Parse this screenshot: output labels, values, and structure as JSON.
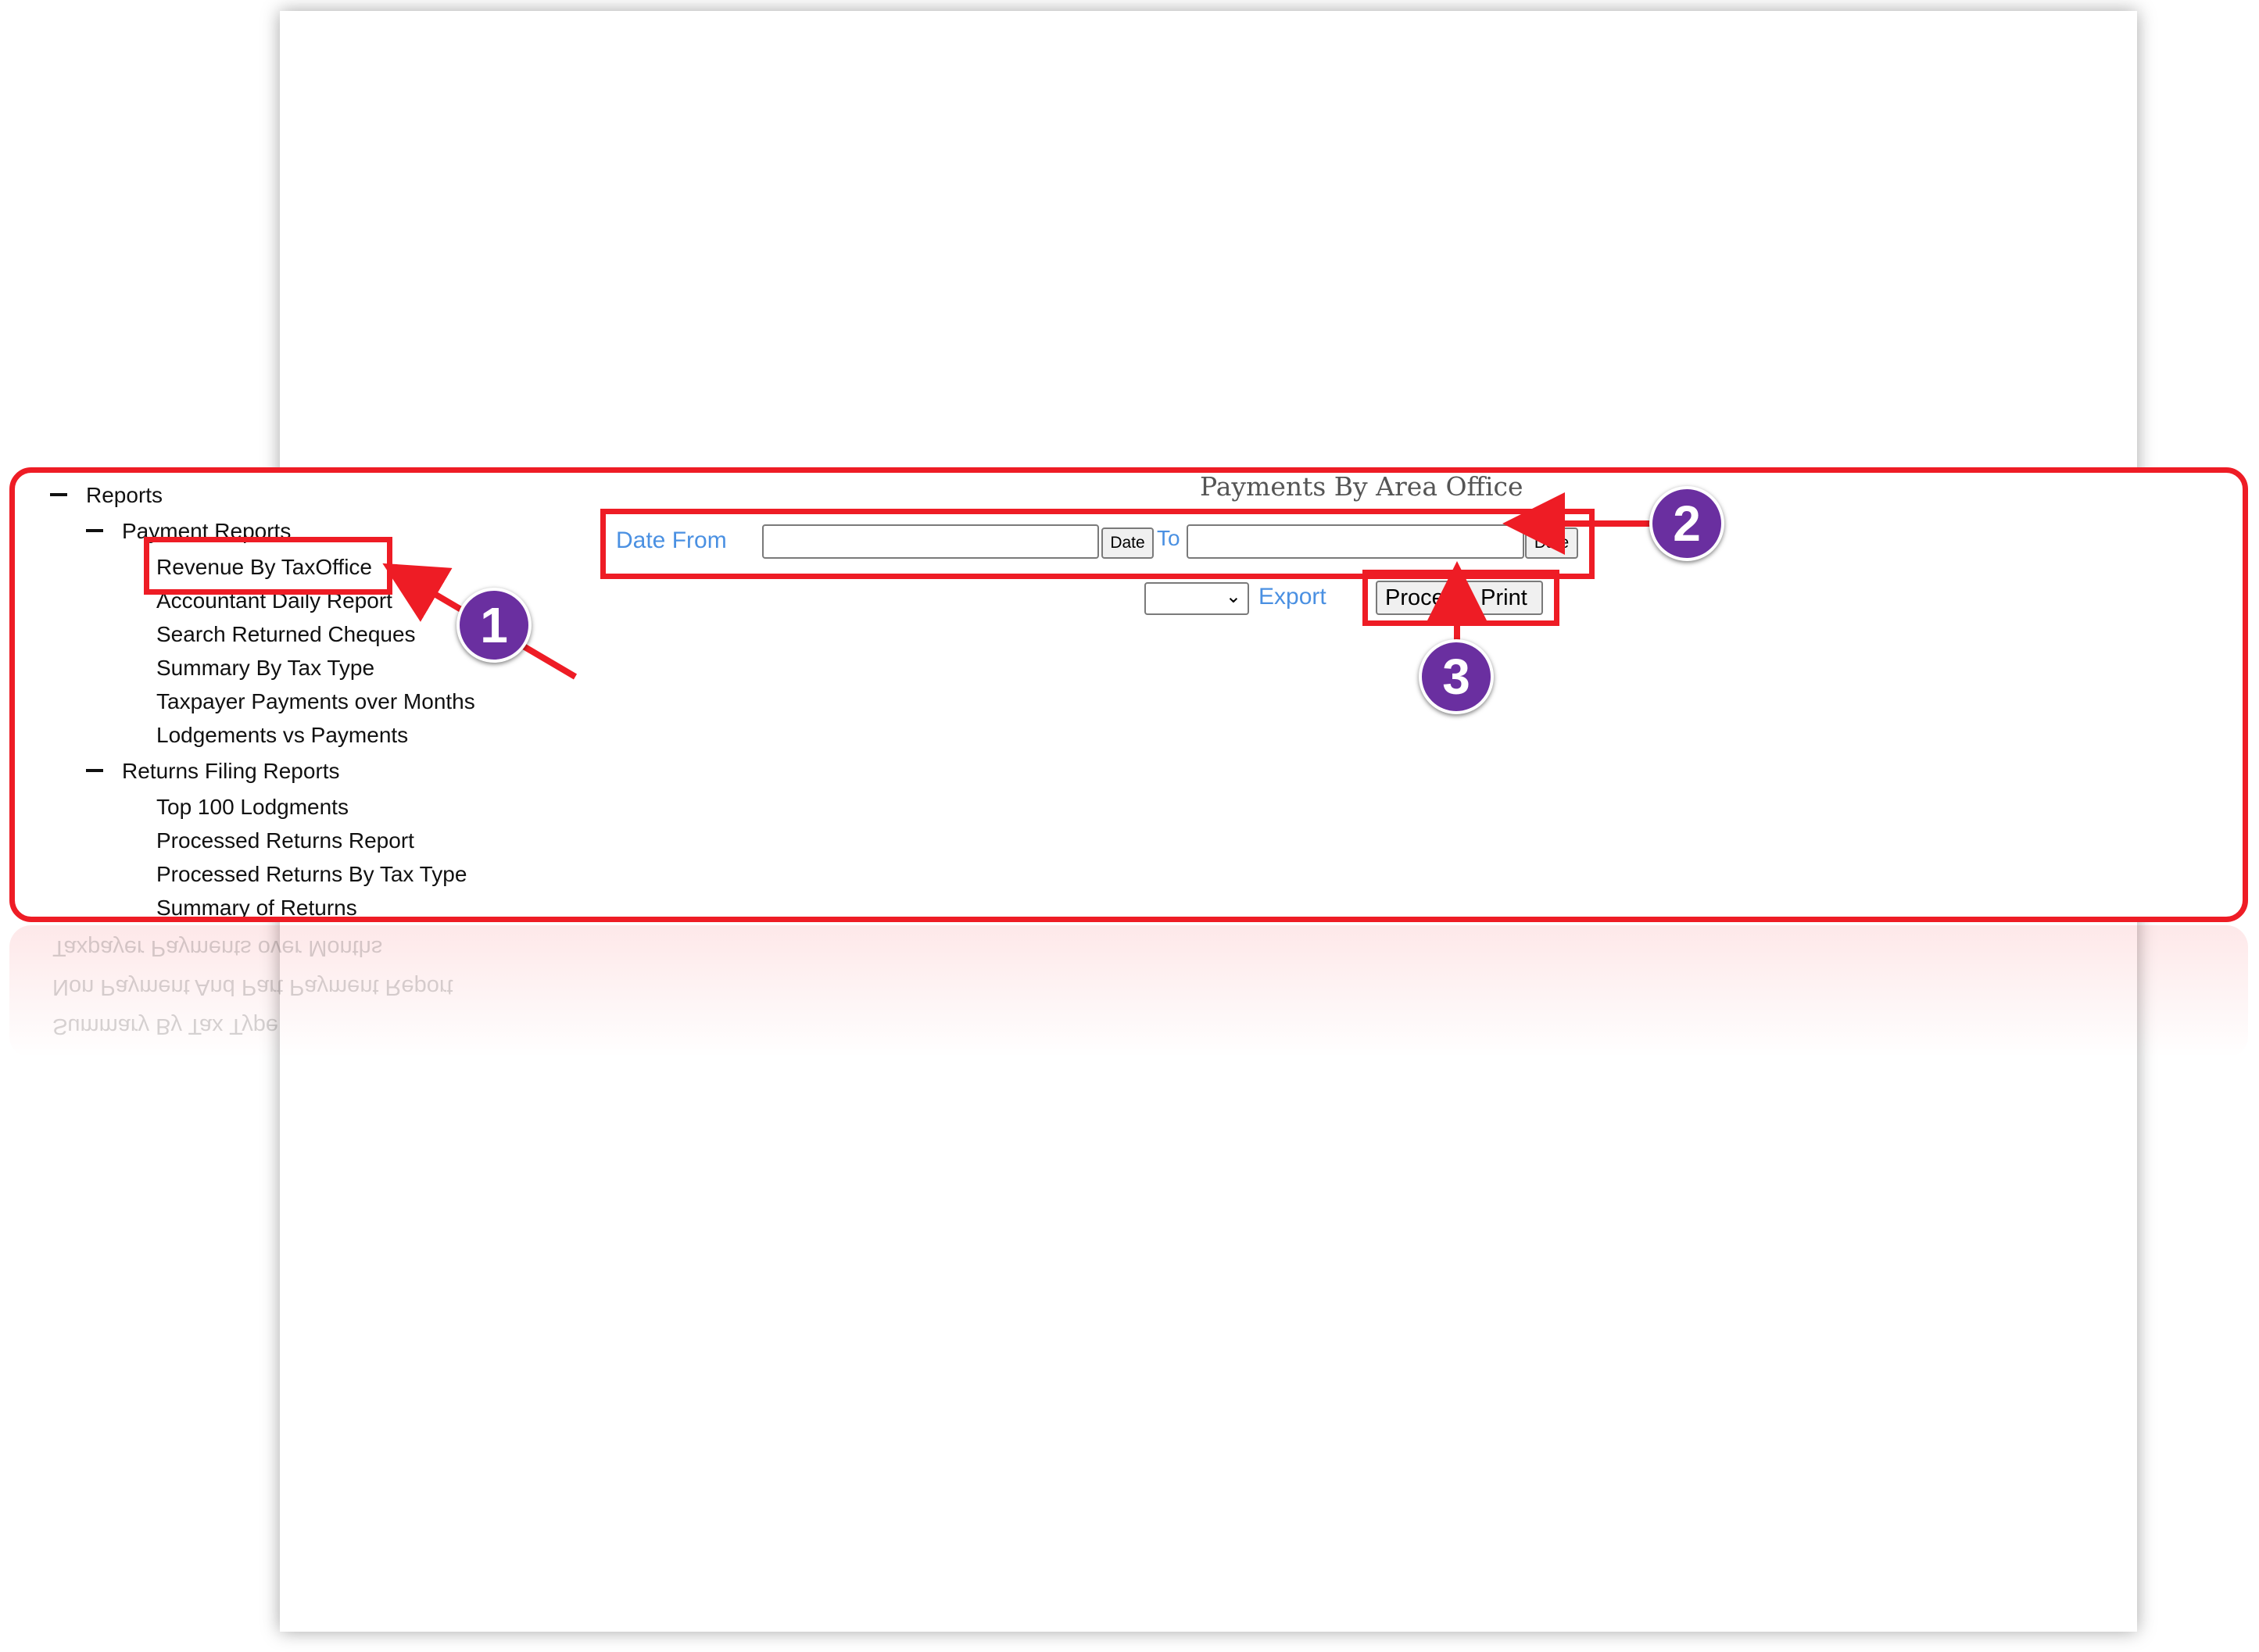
{
  "tree": {
    "root_label": "Reports",
    "payment_reports": {
      "label": "Payment Reports",
      "items": [
        "Revenue By TaxOffice",
        "Accountant Daily Report",
        "Search Returned Cheques",
        "Summary By Tax Type",
        "Taxpayer Payments over Months",
        "Lodgements vs Payments"
      ]
    },
    "returns_reports": {
      "label": "Returns Filing Reports",
      "items": [
        "Top 100 Lodgments",
        "Processed Returns Report",
        "Processed Returns By Tax Type",
        "Summary of Returns"
      ]
    }
  },
  "main": {
    "title": "Payments By Area Office",
    "date_from_label": "Date From",
    "to_label": "To",
    "date_button": "Date",
    "date_from_value": "",
    "date_to_value": "",
    "export_select_value": "",
    "export_label": "Export",
    "process_label": "Process",
    "print_label": "Print"
  },
  "reflection_lines": [
    "Taxpayer Payments over Months",
    "Non Payment And Part Payment Report",
    "Summary By Tax Type"
  ],
  "callouts": [
    "1",
    "2",
    "3"
  ],
  "colors": {
    "highlight": "#ee1c25",
    "badge": "#6a2fa0",
    "link_blue": "#4a90e2"
  }
}
